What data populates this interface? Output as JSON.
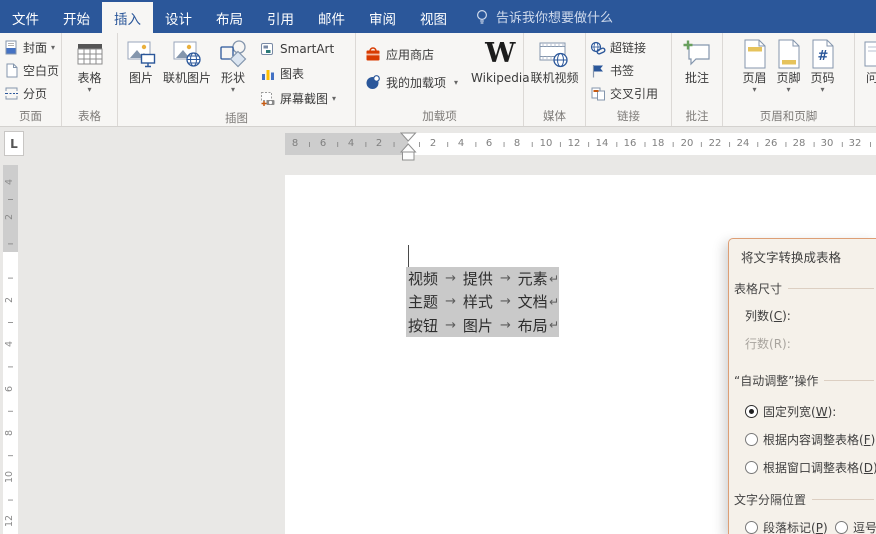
{
  "menu": {
    "tabs": [
      "文件",
      "开始",
      "插入",
      "设计",
      "布局",
      "引用",
      "邮件",
      "审阅",
      "视图"
    ],
    "active_tab": "插入",
    "tell_me": "告诉我你想要做什么"
  },
  "ribbon": {
    "page": {
      "label": "页面",
      "cover": "封面",
      "blank": "空白页",
      "brk": "分页"
    },
    "table": {
      "label": "表格",
      "btn": "表格"
    },
    "illus": {
      "label": "插图",
      "picture": "图片",
      "online_pic": "联机图片",
      "shapes": "形状",
      "smartart": "SmartArt",
      "chart": "图表",
      "screenshot": "屏幕截图"
    },
    "addins": {
      "label": "加载项",
      "store": "应用商店",
      "mine": "我的加载项",
      "wiki": "Wikipedia",
      "w": "W"
    },
    "media": {
      "label": "媒体",
      "video": "联机视频"
    },
    "links": {
      "label": "链接",
      "hyperlink": "超链接",
      "bookmark": "书签",
      "crossref": "交叉引用"
    },
    "comment": {
      "label": "批注",
      "btn": "批注"
    },
    "hf": {
      "label": "页眉和页脚",
      "header": "页眉",
      "footer": "页脚",
      "pagenum": "页码"
    },
    "partial": {
      "text": "问"
    }
  },
  "ruler": {
    "tab_selector": "L",
    "h_margin_numbers": [
      "8",
      "6",
      "4",
      "2"
    ],
    "h_numbers": [
      "2",
      "4",
      "6",
      "8",
      "10",
      "12",
      "14",
      "16",
      "18",
      "20",
      "22",
      "24",
      "26",
      "28",
      "30",
      "32"
    ],
    "v_margin_numbers": [
      "4",
      "2"
    ],
    "v_numbers": [
      "2",
      "4",
      "6",
      "8",
      "10",
      "12"
    ]
  },
  "document": {
    "marks": {
      "tab": "→",
      "para": "↵"
    },
    "lines": [
      {
        "c1": "视频",
        "c2": "提供",
        "c3": "元素"
      },
      {
        "c1": "主题",
        "c2": "样式",
        "c3": "文档"
      },
      {
        "c1": "按钮",
        "c2": "图片",
        "c3": "布局"
      }
    ]
  },
  "dialog": {
    "title": "将文字转换成表格",
    "accent_border": "#dd9e75",
    "size": {
      "header": "表格尺寸",
      "columns": {
        "pre": "列数(",
        "key": "C",
        "post": "):"
      },
      "rows": {
        "pre": "行数(",
        "key": "R",
        "post": "):"
      }
    },
    "autofit": {
      "header": "“自动调整”操作",
      "fixed": {
        "pre": "固定列宽(",
        "key": "W",
        "post": "):"
      },
      "content": {
        "pre": "根据内容调整表格(",
        "key": "F",
        "post": ")"
      },
      "window": {
        "pre": "根据窗口调整表格(",
        "key": "D",
        "post": ")"
      }
    },
    "separator": {
      "header": "文字分隔位置",
      "paragraph": {
        "pre": "段落标记(",
        "key": "P",
        "post": ")"
      },
      "comma": {
        "pre": "逗号",
        "key": "",
        "post": ""
      }
    }
  }
}
